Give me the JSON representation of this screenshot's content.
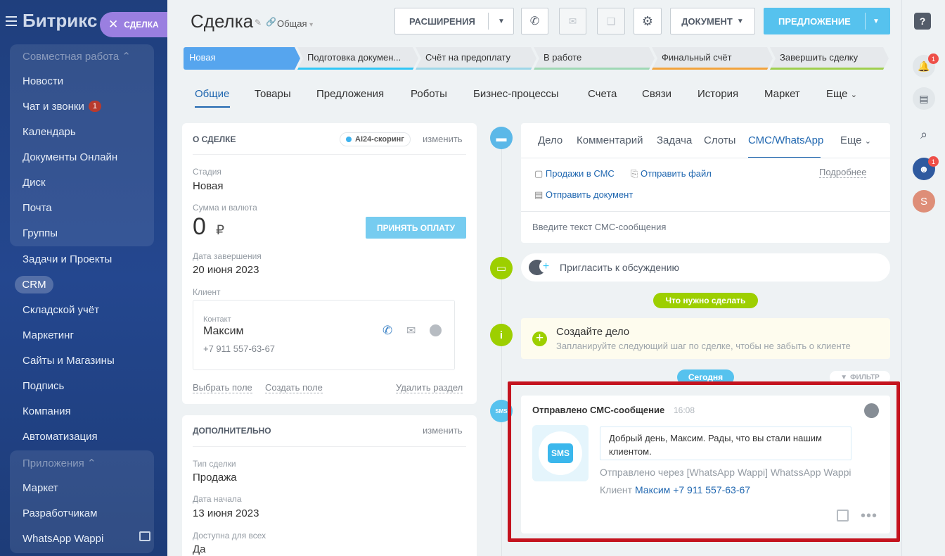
{
  "brand": {
    "name": "Битрикс 24"
  },
  "deal_chip": {
    "label": "СДЕЛКА"
  },
  "left_menu": {
    "collab_header": "Совместная работа",
    "news": "Новости",
    "chat": "Чат и звонки",
    "chat_count": "1",
    "calendar": "Календарь",
    "docs_online": "Документы Онлайн",
    "disk": "Диск",
    "mail": "Почта",
    "groups": "Группы",
    "tasks": "Задачи и Проекты",
    "crm": "CRM",
    "warehouse": "Складской учёт",
    "marketing": "Маркетинг",
    "sites": "Сайты и Магазины",
    "sign": "Подпись",
    "company": "Компания",
    "automation": "Автоматизация",
    "apps_header": "Приложения",
    "market": "Маркет",
    "developers": "Разработчикам",
    "whatsapp_wappi": "WhatsApp Wappi"
  },
  "header": {
    "title": "Сделка",
    "category": "Общая",
    "extensions_label": "РАСШИРЕНИЯ",
    "document_label": "ДОКУМЕНТ",
    "proposal_label": "ПРЕДЛОЖЕНИЕ"
  },
  "stages": [
    "Новая",
    "Подготовка докумен...",
    "Счёт на предоплату",
    "В работе",
    "Финальный счёт",
    "Завершить сделку"
  ],
  "stage_colors": [
    "#56a5ee",
    "#2fc6f6",
    "#9ed6e8",
    "#9fd8b5",
    "#f2a33c",
    "#9fcf4e"
  ],
  "tabs": [
    "Общие",
    "Товары",
    "Предложения",
    "Роботы",
    "Бизнес-процессы",
    "Счета",
    "Связи",
    "История",
    "Маркет",
    "Еще"
  ],
  "about": {
    "caption": "О СДЕЛКЕ",
    "ai_chip": "AI24-скоринг",
    "edit_label": "изменить",
    "stage_label": "Стадия",
    "stage_value": "Новая",
    "amount_label": "Сумма и валюта",
    "amount_value": "0",
    "currency": "₽",
    "pay_button": "ПРИНЯТЬ ОПЛАТУ",
    "close_date_label": "Дата завершения",
    "close_date_value": "20 июня 2023",
    "client_label": "Клиент",
    "contact_label": "Контакт",
    "contact_name": "Максим",
    "contact_phone": "+7 911 557-63-67",
    "select_field": "Выбрать поле",
    "create_field": "Создать поле",
    "delete_section": "Удалить раздел"
  },
  "additional": {
    "caption": "ДОПОЛНИТЕЛЬНО",
    "edit_label": "изменить",
    "deal_type_label": "Тип сделки",
    "deal_type_value": "Продажа",
    "start_date_label": "Дата начала",
    "start_date_value": "13 июня 2023",
    "available_label": "Доступна для всех",
    "available_value": "Да"
  },
  "editor": {
    "tabs": [
      "Дело",
      "Комментарий",
      "Задача",
      "Слоты",
      "СМС/WhatsApp",
      "Еще"
    ],
    "sales_sms": "Продажи в СМС",
    "send_file": "Отправить файл",
    "details": "Подробнее",
    "send_document": "Отправить документ",
    "placeholder": "Введите текст СМС-сообщения"
  },
  "invite": {
    "label": "Пригласить к обсуждению"
  },
  "todo": {
    "label": "Что нужно сделать"
  },
  "create_task": {
    "title": "Создайте дело",
    "subtitle": "Запланируйте следующий шаг по сделке, чтобы не забыть о клиенте"
  },
  "today": {
    "label": "Сегодня",
    "filter": "ФИЛЬТР"
  },
  "sms_event": {
    "title": "Отправлено СМС-сообщение",
    "time": "16:08",
    "sms_badge": "SMS",
    "message": "Добрый день, Максим. Рады, что вы стали нашим клиентом.",
    "via": "Отправлено через [WhatsApp Wappi] WhatssApp Wappi",
    "client_label": "Клиент",
    "client_value": "Максим +7 911 557-63-67"
  },
  "right_panel": {
    "help": "?",
    "notif_count": "1",
    "chat_count": "1",
    "avatar_letter": "S"
  }
}
